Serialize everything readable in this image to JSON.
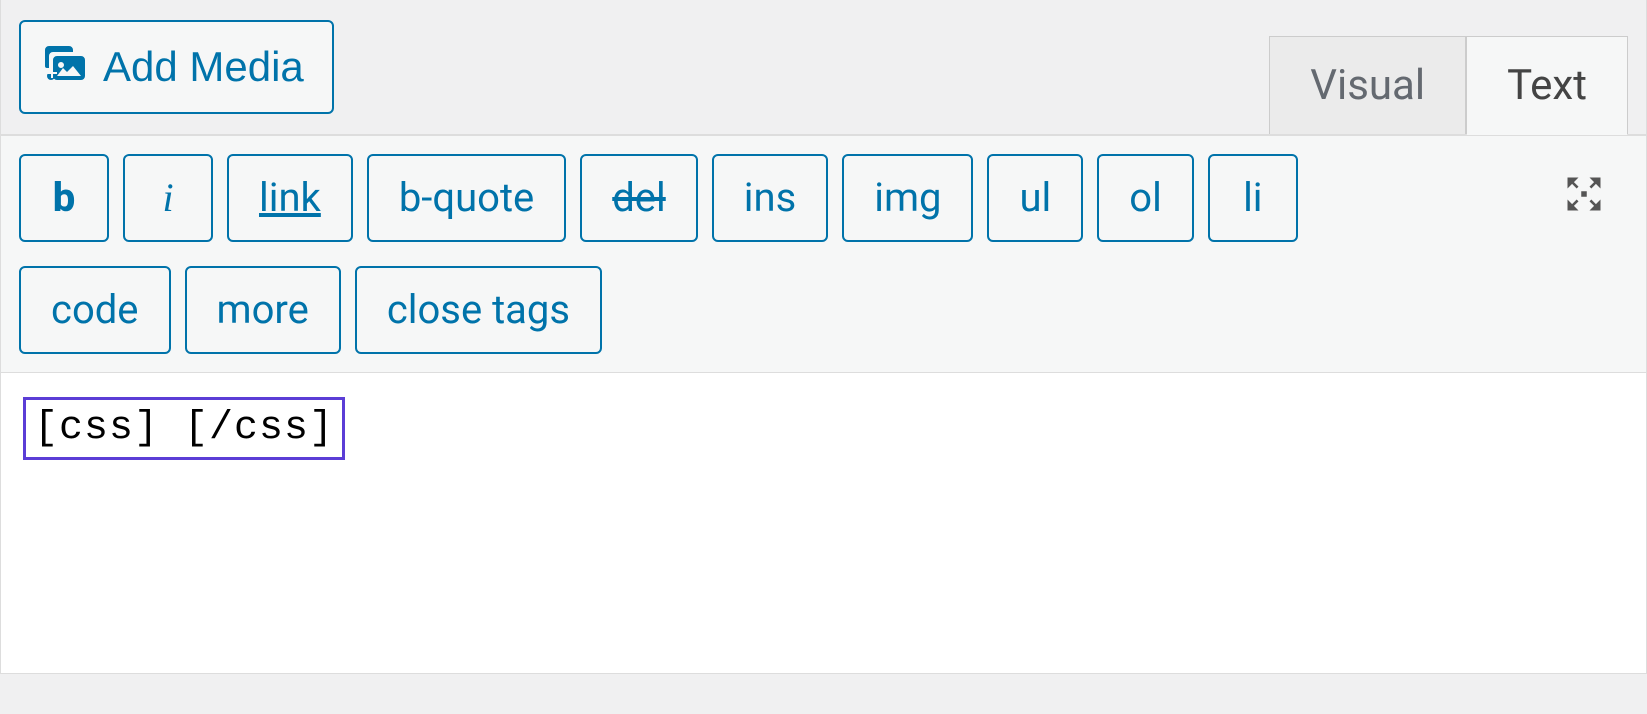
{
  "toolbar": {
    "add_media_label": "Add Media"
  },
  "tabs": {
    "visual_label": "Visual",
    "text_label": "Text"
  },
  "quicktags": {
    "b": "b",
    "i": "i",
    "link": "link",
    "bquote": "b-quote",
    "del": "del",
    "ins": "ins",
    "img": "img",
    "ul": "ul",
    "ol": "ol",
    "li": "li",
    "code": "code",
    "more": "more",
    "close_tags": "close tags"
  },
  "editor": {
    "content": "[css] [/css]"
  }
}
